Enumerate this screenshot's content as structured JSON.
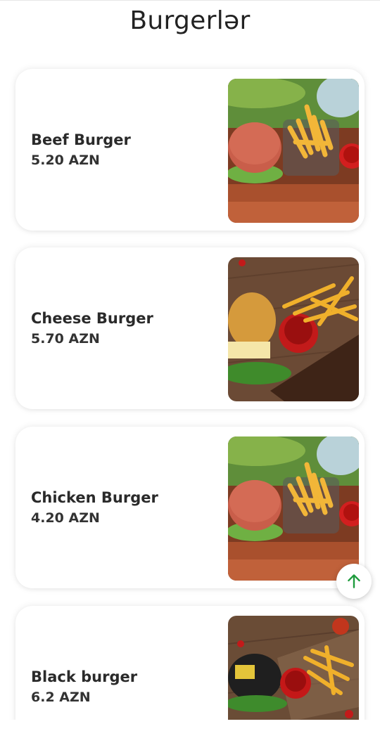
{
  "header": {
    "title": "Burgerlər"
  },
  "products": [
    {
      "name": "Beef Burger",
      "price": "5.20 AZN",
      "photo": "beef-burger-photo"
    },
    {
      "name": "Cheese Burger",
      "price": "5.70 AZN",
      "photo": "cheese-burger-photo"
    },
    {
      "name": "Chicken Burger",
      "price": "4.20 AZN",
      "photo": "chicken-burger-photo"
    },
    {
      "name": "Black burger",
      "price": "6.2 AZN",
      "photo": "black-burger-photo"
    }
  ],
  "scroll_top": {
    "icon": "arrow-up-icon",
    "color": "#1e9b3d"
  }
}
